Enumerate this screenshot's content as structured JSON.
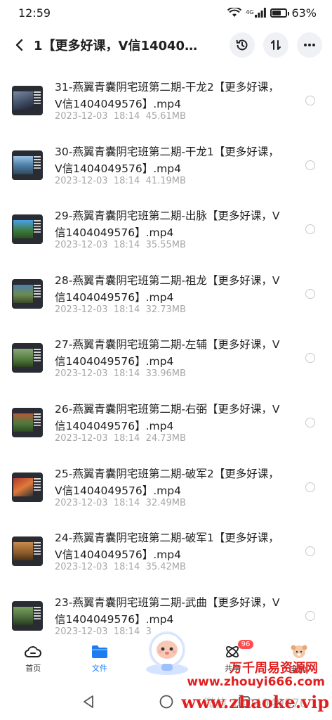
{
  "status_bar": {
    "time": "12:59",
    "battery": "63%",
    "battery_level": 0.63,
    "network": "4G"
  },
  "header": {
    "title": "1【更多好课，V信1404049…"
  },
  "files": [
    {
      "name": "31-燕翼青囊阴宅班第二期-干龙2【更多好课，V信1404049576】.mp4",
      "date": "2023-12-03",
      "time": "18:14",
      "size": "45.61MB"
    },
    {
      "name": "30-燕翼青囊阴宅班第二期-干龙1【更多好课，V信1404049576】.mp4",
      "date": "2023-12-03",
      "time": "18:14",
      "size": "41.19MB"
    },
    {
      "name": "29-燕翼青囊阴宅班第二期-出脉【更多好课，V信1404049576】.mp4",
      "date": "2023-12-03",
      "time": "18:14",
      "size": "35.55MB"
    },
    {
      "name": "28-燕翼青囊阴宅班第二期-祖龙【更多好课，V信1404049576】.mp4",
      "date": "2023-12-03",
      "time": "18:14",
      "size": "32.73MB"
    },
    {
      "name": "27-燕翼青囊阴宅班第二期-左辅【更多好课，V信1404049576】.mp4",
      "date": "2023-12-03",
      "time": "18:14",
      "size": "33.96MB"
    },
    {
      "name": "26-燕翼青囊阴宅班第二期-右弼【更多好课，V信1404049576】.mp4",
      "date": "2023-12-03",
      "time": "18:14",
      "size": "24.73MB"
    },
    {
      "name": "25-燕翼青囊阴宅班第二期-破军2【更多好课，V信1404049576】.mp4",
      "date": "2023-12-03",
      "time": "18:14",
      "size": "32.49MB"
    },
    {
      "name": "24-燕翼青囊阴宅班第二期-破军1【更多好课，V信1404049576】.mp4",
      "date": "2023-12-03",
      "time": "18:14",
      "size": "35.42MB"
    },
    {
      "name": "23-燕翼青囊阴宅班第二期-武曲【更多好课，V信1404049576】.mp4",
      "date": "2023-12-03",
      "time": "18:14",
      "size": "3"
    }
  ],
  "tabs": [
    {
      "label": "首页",
      "icon": "cloud-icon"
    },
    {
      "label": "文件",
      "icon": "folder-icon",
      "active": true
    },
    {
      "label": "",
      "icon": "mascot-icon"
    },
    {
      "label": "共享",
      "icon": "share-icon",
      "badge": "96"
    },
    {
      "label": "我的",
      "icon": "avatar-icon"
    }
  ],
  "watermark": {
    "line1": "万千周易资源网",
    "line2": "www.zhouyi666.com",
    "line3": "www.zhaoke.vip",
    "ghost": "微信 1404049576"
  },
  "colors": {
    "accent": "#1d7cf2",
    "watermark": "#e02020",
    "meta": "#a7a7a7"
  }
}
